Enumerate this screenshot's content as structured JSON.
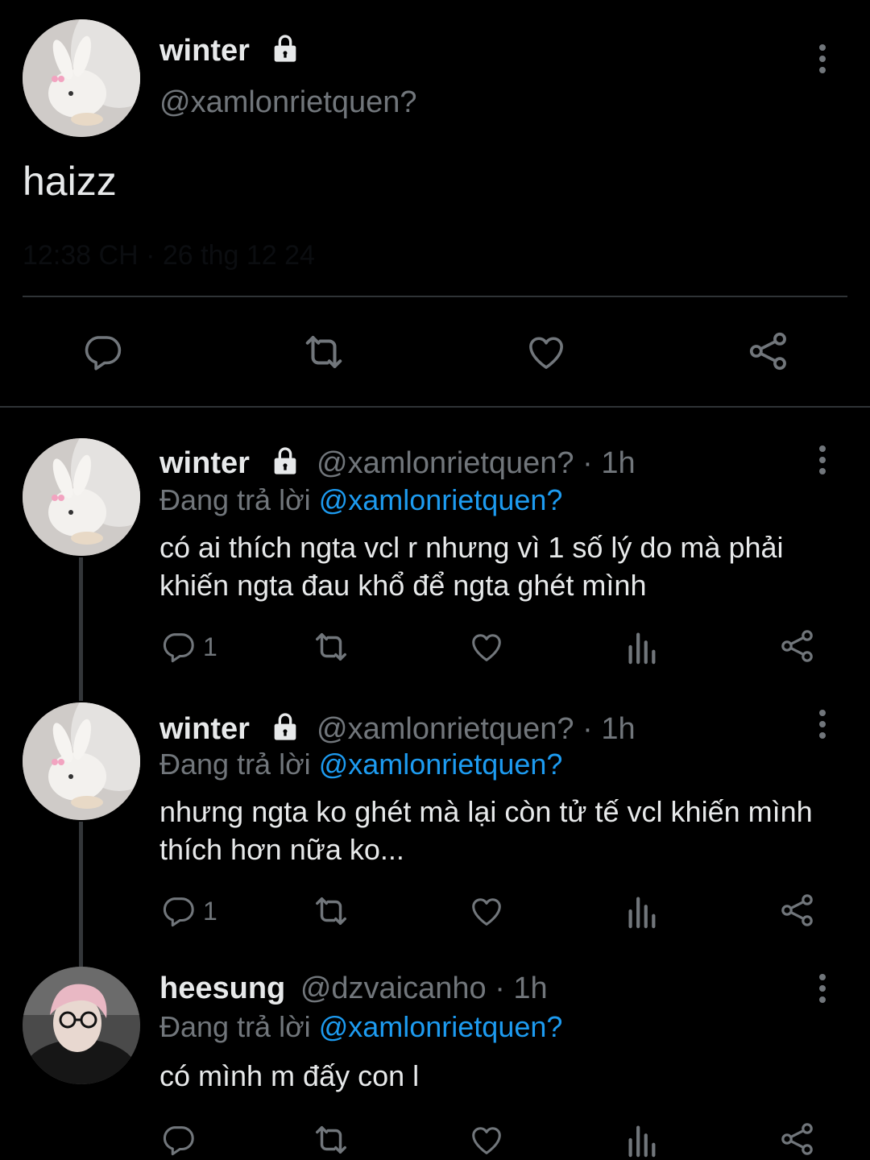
{
  "main_tweet": {
    "name": "winter",
    "handle": "@xamlonrietquen?",
    "text": "haizz",
    "timestamp": "12:38 CH · 26 thg 12 24"
  },
  "replies": [
    {
      "name": "winter",
      "handle": "@xamlonrietquen?",
      "time": "· 1h",
      "replying_prefix": "Đang trả lời",
      "replying_to": "@xamlonrietquen?",
      "text": "có ai thích ngta vcl r nhưng vì 1 số lý do mà phải khiến ngta đau khổ để ngta ghét mình",
      "reply_count": "1",
      "locked": true
    },
    {
      "name": "winter",
      "handle": "@xamlonrietquen?",
      "time": "· 1h",
      "replying_prefix": "Đang trả lời",
      "replying_to": "@xamlonrietquen?",
      "text": "nhưng ngta ko ghét mà lại còn tử tế vcl khiến mình thích hơn nữa ko...",
      "reply_count": "1",
      "locked": true
    },
    {
      "name": "heesung",
      "handle": "@dzvaicanho",
      "time": "· 1h",
      "replying_prefix": "Đang trả lời",
      "replying_to": "@xamlonrietquen?",
      "text": "có mình m đấy con l",
      "reply_count": "",
      "locked": false
    }
  ],
  "icons": {
    "reply": "reply-icon",
    "retweet": "retweet-icon",
    "like": "heart-icon",
    "views": "views-icon",
    "share": "share-icon",
    "lock": "lock-icon",
    "more": "more-icon"
  },
  "colors": {
    "background": "#000000",
    "text": "#e7e9ea",
    "secondary": "#71767b",
    "link": "#1d9bf0",
    "divider": "#2f3336"
  }
}
